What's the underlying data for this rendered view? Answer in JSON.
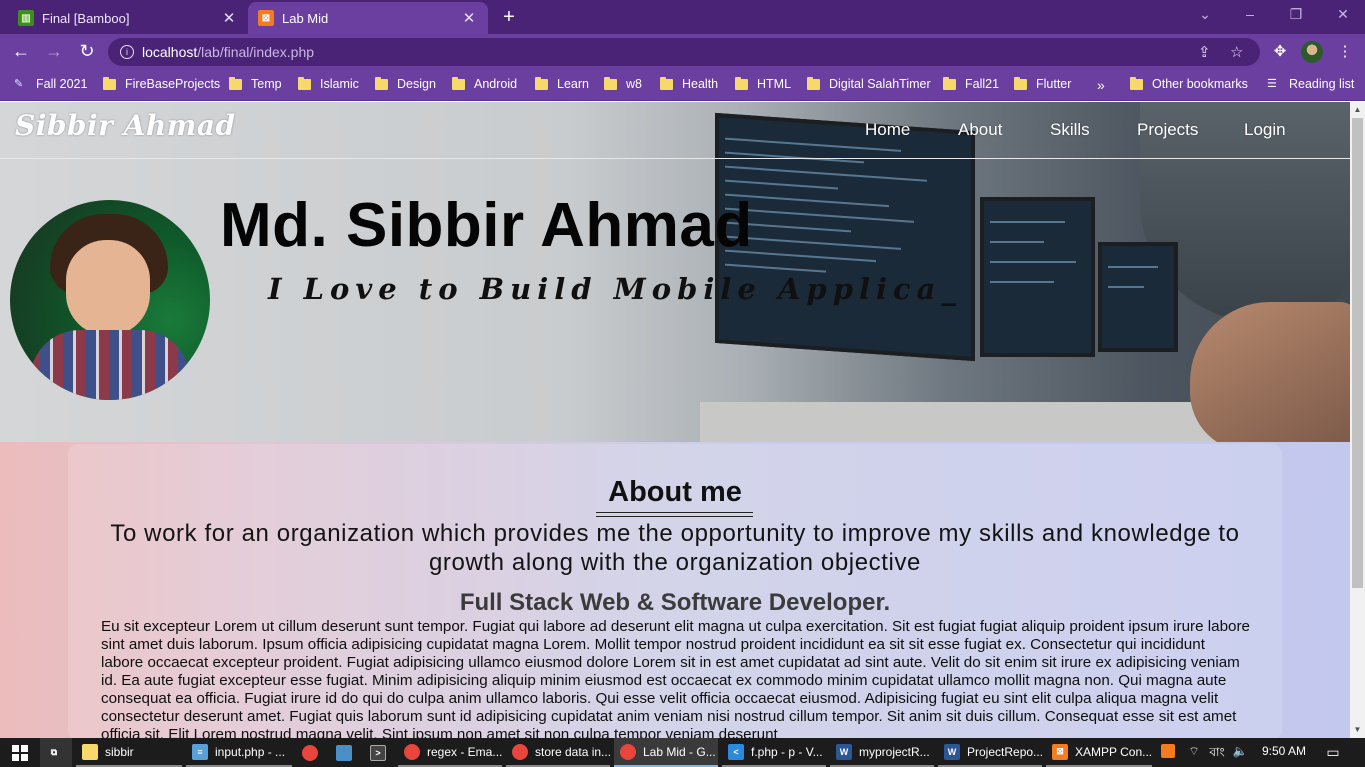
{
  "browser": {
    "tabs": [
      {
        "title": "Final [Bamboo]",
        "active": false
      },
      {
        "title": "Lab Mid",
        "active": true
      }
    ],
    "url_host": "localhost",
    "url_path": "/lab/final/index.php",
    "bookmarks": [
      "Fall 2021",
      "FireBaseProjects",
      "Temp",
      "Islamic",
      "Design",
      "Android",
      "Learn",
      "w8",
      "Health",
      "HTML",
      "Digital SalahTimer",
      "Fall21",
      "Flutter"
    ],
    "bookmarks_overflow": "»",
    "other_bookmarks": "Other bookmarks",
    "reading_list": "Reading list"
  },
  "site": {
    "logo": "Sibbir Ahmad",
    "nav": [
      "Home",
      "About",
      "Skills",
      "Projects",
      "Login"
    ],
    "hero_name": "Md. Sibbir Ahmad",
    "hero_tagline": "I Love to Build Mobile Applica_",
    "about": {
      "title": "About me",
      "objective": "To work for an organization which provides me the opportunity to improve my skills and knowledge to growth along with the organization objective",
      "role": "Full Stack Web & Software Developer.",
      "body": "Eu sit excepteur Lorem ut cillum deserunt sunt tempor. Fugiat qui labore ad deserunt elit magna ut culpa exercitation. Sit est fugiat fugiat aliquip proident ipsum irure labore sint amet duis laborum. Ipsum officia adipisicing cupidatat magna Lorem. Mollit tempor nostrud proident incididunt ea sit sit esse fugiat ex. Consectetur qui incididunt labore occaecat excepteur proident. Fugiat adipisicing ullamco eiusmod dolore Lorem sit in est amet cupidatat ad sint aute. Velit do sit enim sit irure ex adipisicing veniam id. Ea aute fugiat excepteur esse fugiat. Minim adipisicing aliquip minim eiusmod est occaecat ex commodo minim cupidatat ullamco mollit magna non. Qui magna aute consequat ea officia. Fugiat irure id do qui do culpa anim ullamco laboris. Qui esse velit officia occaecat eiusmod. Adipisicing fugiat eu sint elit culpa aliqua magna velit consectetur deserunt amet. Fugiat quis laborum sunt id adipisicing cupidatat anim veniam nisi nostrud cillum tempor. Sit anim sit duis cillum. Consequat esse sit est amet officia sit. Elit Lorem nostrud magna velit. Sint ipsum non amet sit non culpa tempor veniam deserunt"
    }
  },
  "taskbar": {
    "items": [
      {
        "label": "sibbir",
        "icon": "folder-icon",
        "color": "#f6d86b"
      },
      {
        "label": "input.php - ...",
        "icon": "notepad-icon",
        "color": "#5aa0d8"
      },
      {
        "label": "",
        "icon": "chrome-icon",
        "color": "#e8453c"
      },
      {
        "label": "",
        "icon": "app-icon",
        "color": "#4a90c8"
      },
      {
        "label": "",
        "icon": "terminal-icon",
        "color": "#444444"
      },
      {
        "label": "regex - Ema...",
        "icon": "chrome-icon",
        "color": "#e8453c"
      },
      {
        "label": "store data in...",
        "icon": "chrome-icon",
        "color": "#e8453c"
      },
      {
        "label": "Lab Mid - G...",
        "icon": "chrome-icon",
        "color": "#e8453c"
      },
      {
        "label": "f.php - p - V...",
        "icon": "vscode-icon",
        "color": "#2b8ae0"
      },
      {
        "label": "myprojectR...",
        "icon": "word-icon",
        "color": "#2b5797"
      },
      {
        "label": "ProjectRepo...",
        "icon": "word-icon",
        "color": "#2b5797"
      },
      {
        "label": "XAMPP Con...",
        "icon": "xampp-icon",
        "color": "#f47b20"
      }
    ],
    "clock": "9:50 AM",
    "lang": "বাং"
  }
}
